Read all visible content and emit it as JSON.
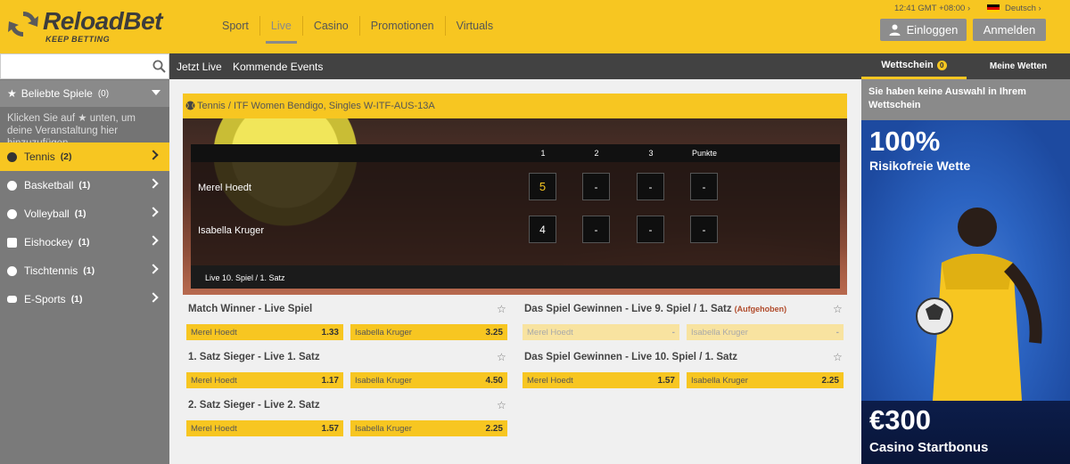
{
  "header": {
    "brand": "ReloadBet",
    "tagline": "KEEP BETTING",
    "nav": [
      "Sport",
      "Live",
      "Casino",
      "Promotionen",
      "Virtuals"
    ],
    "active_nav": "Live",
    "clock": "12:41 GMT +08:00 ›",
    "language": "Deutsch ›",
    "login_label": "Einloggen",
    "register_label": "Anmelden",
    "accent_color": "#f7c621"
  },
  "sidebar": {
    "search_placeholder": "",
    "favorites": {
      "label": "Beliebte Spiele",
      "count": "(0)"
    },
    "favorites_hint": "Klicken Sie auf ★ unten, um deine Veranstaltung hier hinzuzufügen",
    "sports": [
      {
        "name": "Tennis",
        "count": "(2)",
        "icon": "tennis-ball-icon"
      },
      {
        "name": "Basketball",
        "count": "(1)",
        "icon": "basketball-icon"
      },
      {
        "name": "Volleyball",
        "count": "(1)",
        "icon": "volleyball-icon"
      },
      {
        "name": "Eishockey",
        "count": "(1)",
        "icon": "ice-hockey-icon"
      },
      {
        "name": "Tischtennis",
        "count": "(1)",
        "icon": "table-tennis-icon"
      },
      {
        "name": "E-Sports",
        "count": "(1)",
        "icon": "gamepad-icon"
      }
    ]
  },
  "subnav": [
    "Jetzt Live",
    "Kommende Events"
  ],
  "event": {
    "title": "Tennis / ITF Women Bendigo, Singles W-ITF-AUS-13A",
    "columns": [
      "1",
      "2",
      "3",
      "Punkte"
    ],
    "players": [
      {
        "name": "Merel Hoedt",
        "scores": [
          "5",
          "-",
          "-",
          "-"
        ]
      },
      {
        "name": "Isabella Kruger",
        "scores": [
          "4",
          "-",
          "-",
          "-"
        ]
      }
    ],
    "status": "Live 10. Spiel / 1. Satz"
  },
  "markets": [
    {
      "title": "Match Winner - Live Spiel",
      "note": "",
      "odds": [
        {
          "name": "Merel Hoedt",
          "value": "1.33"
        },
        {
          "name": "Isabella Kruger",
          "value": "3.25"
        }
      ]
    },
    {
      "title": "Das Spiel Gewinnen - Live 9. Spiel / 1. Satz",
      "note": "(Aufgehoben)",
      "odds": [
        {
          "name": "Merel Hoedt",
          "value": "-"
        },
        {
          "name": "Isabella Kruger",
          "value": "-"
        }
      ]
    },
    {
      "title": "1. Satz Sieger - Live 1. Satz",
      "note": "",
      "odds": [
        {
          "name": "Merel Hoedt",
          "value": "1.17"
        },
        {
          "name": "Isabella Kruger",
          "value": "4.50"
        }
      ]
    },
    {
      "title": "Das Spiel Gewinnen - Live 10. Spiel / 1. Satz",
      "note": "",
      "odds": [
        {
          "name": "Merel Hoedt",
          "value": "1.57"
        },
        {
          "name": "Isabella Kruger",
          "value": "2.25"
        }
      ]
    },
    {
      "title": "2. Satz Sieger - Live 2. Satz",
      "note": "",
      "odds": [
        {
          "name": "Merel Hoedt",
          "value": "1.57"
        },
        {
          "name": "Isabella Kruger",
          "value": "2.25"
        }
      ]
    }
  ],
  "betslip": {
    "tab_active": "Wettschein",
    "badge": "0",
    "tab_other": "Meine Wetten",
    "empty_message": "Sie haben keine Auswahl in Ihrem Wettschein"
  },
  "promo": {
    "headline": "100%",
    "subline": "Risikofreie Wette",
    "amount": "€300",
    "label": "Casino Startbonus"
  }
}
